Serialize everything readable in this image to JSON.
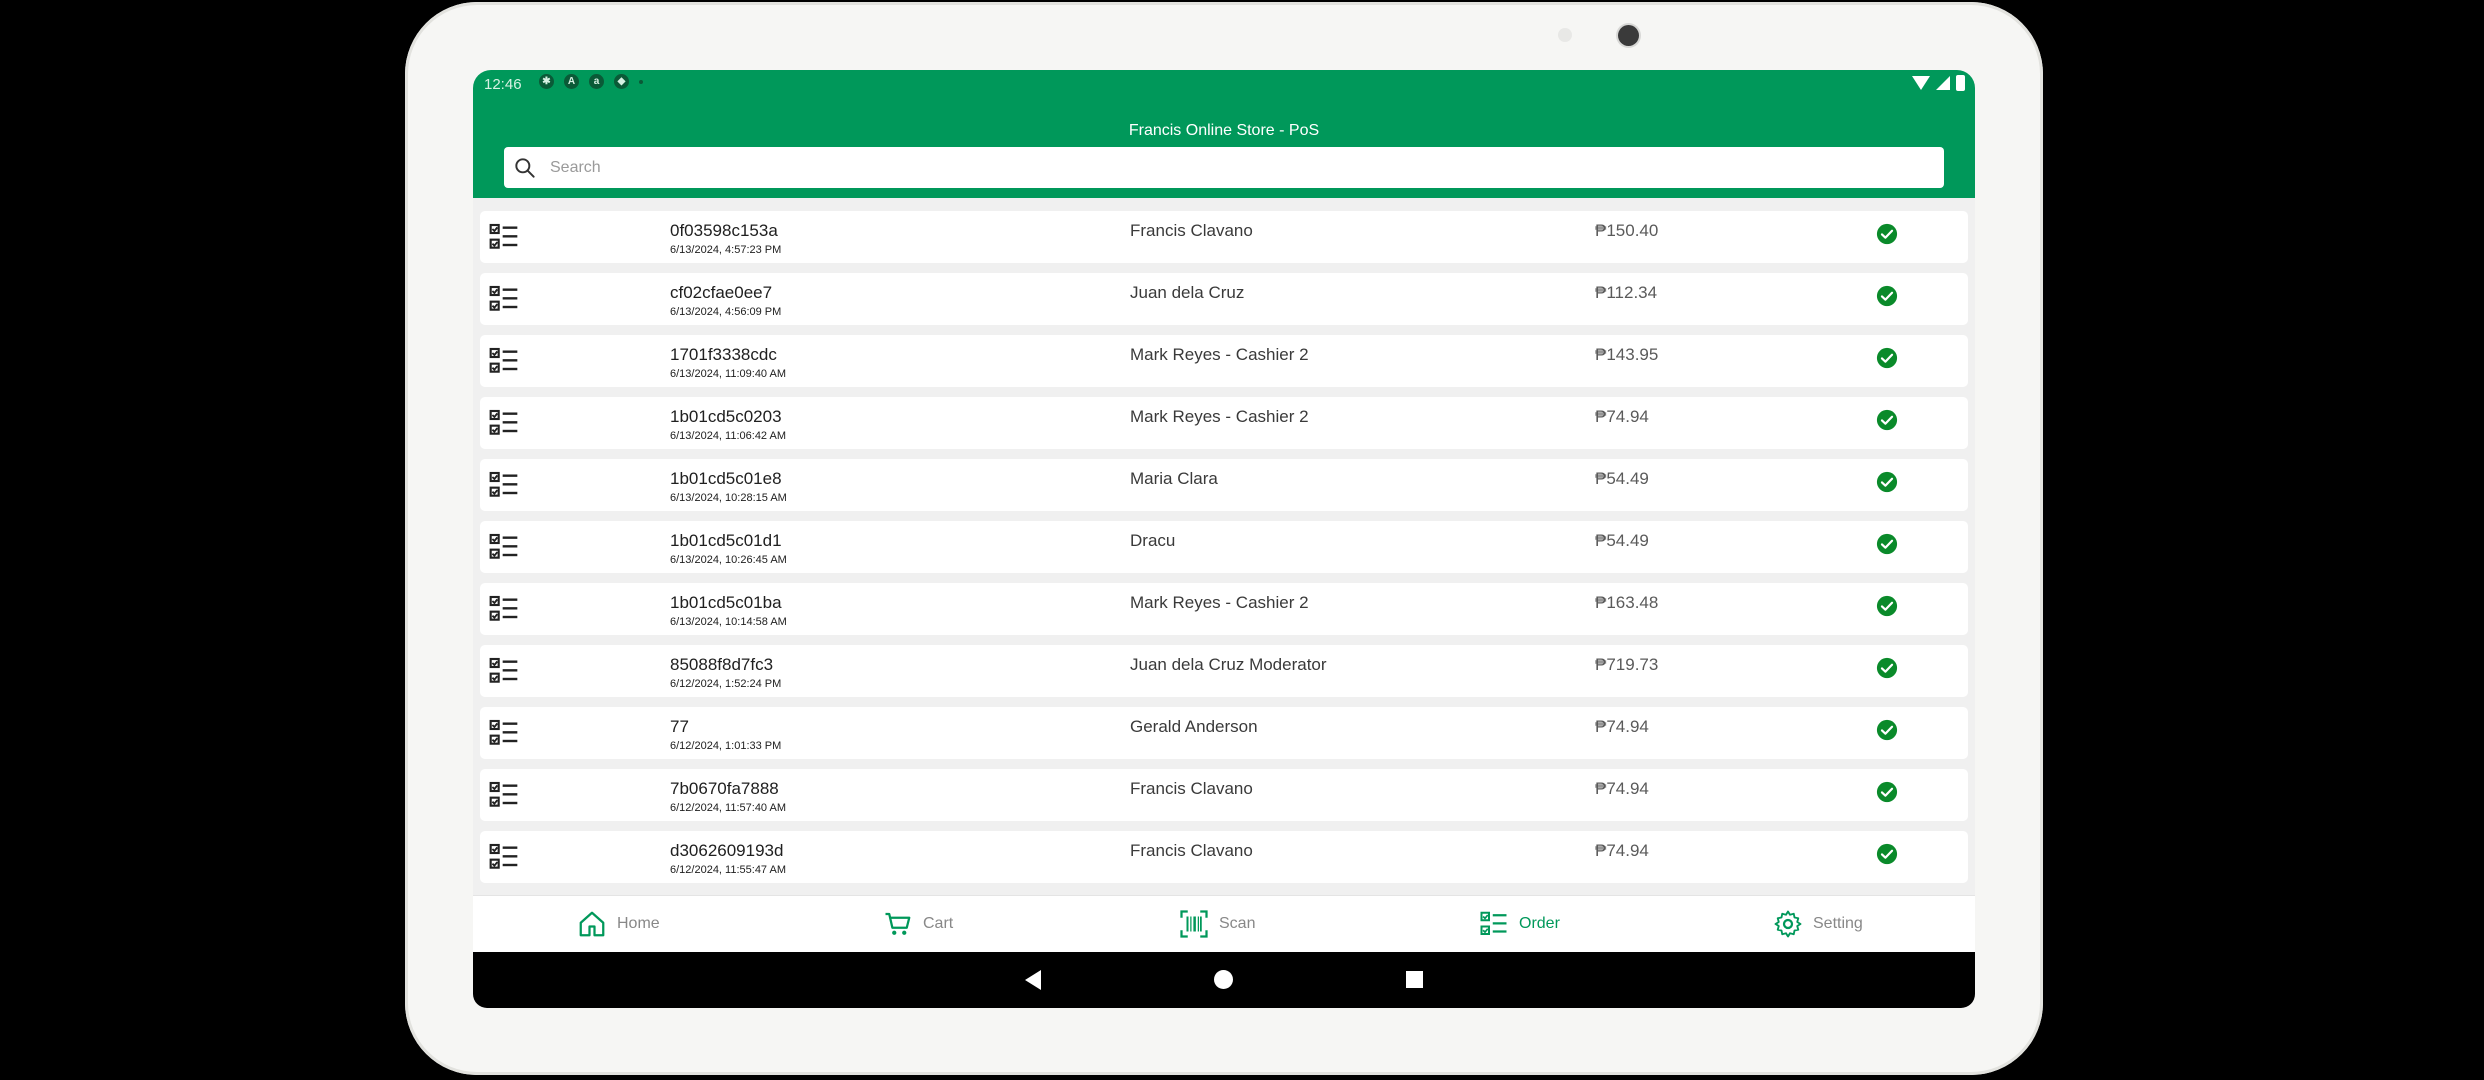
{
  "status_bar": {
    "time": "12:46"
  },
  "app": {
    "title": "Francis Online Store - PoS"
  },
  "search": {
    "placeholder": "Search"
  },
  "orders": [
    {
      "id": "0f03598c153a",
      "date": "6/13/2024, 4:57:23 PM",
      "customer": "Francis Clavano",
      "amount": "₱150.40",
      "status_icon": "check-circle-icon"
    },
    {
      "id": "cf02cfae0ee7",
      "date": "6/13/2024, 4:56:09 PM",
      "customer": "Juan dela Cruz",
      "amount": "₱112.34",
      "status_icon": "check-circle-icon"
    },
    {
      "id": "1701f3338cdc",
      "date": "6/13/2024, 11:09:40 AM",
      "customer": "Mark Reyes - Cashier 2",
      "amount": "₱143.95",
      "status_icon": "check-circle-icon"
    },
    {
      "id": "1b01cd5c0203",
      "date": "6/13/2024, 11:06:42 AM",
      "customer": "Mark Reyes - Cashier 2",
      "amount": "₱74.94",
      "status_icon": "check-circle-icon"
    },
    {
      "id": "1b01cd5c01e8",
      "date": "6/13/2024, 10:28:15 AM",
      "customer": "Maria Clara",
      "amount": "₱54.49",
      "status_icon": "check-circle-icon"
    },
    {
      "id": "1b01cd5c01d1",
      "date": "6/13/2024, 10:26:45 AM",
      "customer": "Dracu",
      "amount": "₱54.49",
      "status_icon": "check-circle-icon"
    },
    {
      "id": "1b01cd5c01ba",
      "date": "6/13/2024, 10:14:58 AM",
      "customer": "Mark Reyes - Cashier 2",
      "amount": "₱163.48",
      "status_icon": "check-circle-icon"
    },
    {
      "id": "85088f8d7fc3",
      "date": "6/12/2024, 1:52:24 PM",
      "customer": "Juan dela Cruz Moderator",
      "amount": "₱719.73",
      "status_icon": "check-circle-icon"
    },
    {
      "id": "77",
      "date": "6/12/2024, 1:01:33 PM",
      "customer": "Gerald Anderson",
      "amount": "₱74.94",
      "status_icon": "check-circle-icon"
    },
    {
      "id": "7b0670fa7888",
      "date": "6/12/2024, 11:57:40 AM",
      "customer": "Francis Clavano",
      "amount": "₱74.94",
      "status_icon": "check-circle-icon"
    },
    {
      "id": "d3062609193d",
      "date": "6/12/2024, 11:55:47 AM",
      "customer": "Francis Clavano",
      "amount": "₱74.94",
      "status_icon": "check-circle-icon"
    }
  ],
  "nav": {
    "home": "Home",
    "cart": "Cart",
    "scan": "Scan",
    "order": "Order",
    "setting": "Setting",
    "active": "order"
  },
  "colors": {
    "brand": "#00985a",
    "check": "#0a8a2a"
  }
}
